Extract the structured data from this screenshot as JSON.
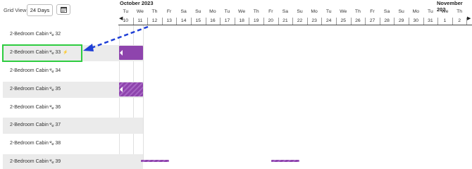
{
  "toolbar": {
    "grid_view_label": "Grid View:",
    "grid_view_value": "24 Days"
  },
  "months": {
    "current": "October 2023",
    "next": "November 202"
  },
  "days": [
    {
      "dow": "Tu",
      "date": "10"
    },
    {
      "dow": "We",
      "date": "11"
    },
    {
      "dow": "Th",
      "date": "12"
    },
    {
      "dow": "Fr",
      "date": "13"
    },
    {
      "dow": "Sa",
      "date": "14"
    },
    {
      "dow": "Su",
      "date": "15"
    },
    {
      "dow": "Mo",
      "date": "16"
    },
    {
      "dow": "Tu",
      "date": "17"
    },
    {
      "dow": "We",
      "date": "18"
    },
    {
      "dow": "Th",
      "date": "19"
    },
    {
      "dow": "Fr",
      "date": "20"
    },
    {
      "dow": "Sa",
      "date": "21"
    },
    {
      "dow": "Su",
      "date": "22"
    },
    {
      "dow": "Mo",
      "date": "23"
    },
    {
      "dow": "Tu",
      "date": "24"
    },
    {
      "dow": "We",
      "date": "25"
    },
    {
      "dow": "Th",
      "date": "26"
    },
    {
      "dow": "Fr",
      "date": "27"
    },
    {
      "dow": "Sa",
      "date": "28"
    },
    {
      "dow": "Su",
      "date": "29"
    },
    {
      "dow": "Mo",
      "date": "30"
    },
    {
      "dow": "Tu",
      "date": "31"
    },
    {
      "dow": "We",
      "date": "1"
    },
    {
      "dow": "Th",
      "date": "2"
    }
  ],
  "rooms": [
    {
      "name": "2-Bedroom Cabin",
      "number": "32"
    },
    {
      "name": "2-Bedroom Cabin",
      "number": "33",
      "flag": "⚡"
    },
    {
      "name": "2-Bedroom Cabin",
      "number": "34"
    },
    {
      "name": "2-Bedroom Cabin",
      "number": "35"
    },
    {
      "name": "2-Bedroom Cabin",
      "number": "36"
    },
    {
      "name": "2-Bedroom Cabin",
      "number": "37"
    },
    {
      "name": "2-Bedroom Cabin",
      "number": "38"
    },
    {
      "name": "2-Bedroom Cabin",
      "number": "39"
    }
  ],
  "icons": {
    "pet": "paw-icon",
    "calendar": "calendar-icon",
    "prev": "prev-arrow-icon",
    "next": "next-arrow-icon"
  },
  "colors": {
    "booking": "#8e44ad",
    "highlight": "#2ecc40",
    "annotation_arrow": "#1f3fd6"
  }
}
